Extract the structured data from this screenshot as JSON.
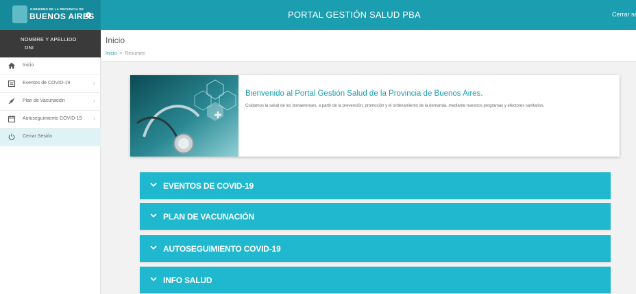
{
  "header": {
    "logo_small": "GOBIERNO DE LA PROVINCIA DE",
    "logo_big": "BUENOS AIRES",
    "title": "PORTAL GESTIÓN SALUD PBA",
    "logout": "Cerrar sesi"
  },
  "sidebar": {
    "user_name": "NOMBRE Y APELLIDO",
    "user_dni": "DNI",
    "items": [
      {
        "label": "Inicio",
        "icon": "home-icon",
        "chevron": false
      },
      {
        "label": "Eventos de COVID-19",
        "icon": "calendar-list-icon",
        "chevron": true
      },
      {
        "label": "Plan de Vacunación",
        "icon": "syringe-icon",
        "chevron": true
      },
      {
        "label": "Autoseguimiento COVID-19",
        "icon": "calendar-icon",
        "chevron": true
      },
      {
        "label": "Cerrar Sesión",
        "icon": "power-icon",
        "chevron": false
      }
    ],
    "chevron_glyph": "›"
  },
  "page": {
    "title": "Inicio",
    "breadcrumb": {
      "link": "Inicio",
      "sep": ">",
      "current": "Resumen"
    }
  },
  "welcome": {
    "title": "Bienvenido al Portal Gestión Salud de la Provincia de Buenos Aires.",
    "text": "Cuidamos la salud de los bonaerenses, a partir de la prevención, promoción y el ordenamiento de la demanda, mediante nuestros programas y efectores sanitarios."
  },
  "accordions": [
    {
      "label": "EVENTOS DE COVID-19"
    },
    {
      "label": "PLAN DE VACUNACIÓN"
    },
    {
      "label": "AUTOSEGUIMIENTO COVID-19"
    },
    {
      "label": "INFO SALUD"
    }
  ],
  "colors": {
    "brand": "#1a9eb0",
    "accordion": "#1fb8cf",
    "user_box": "#3a3a3a"
  }
}
